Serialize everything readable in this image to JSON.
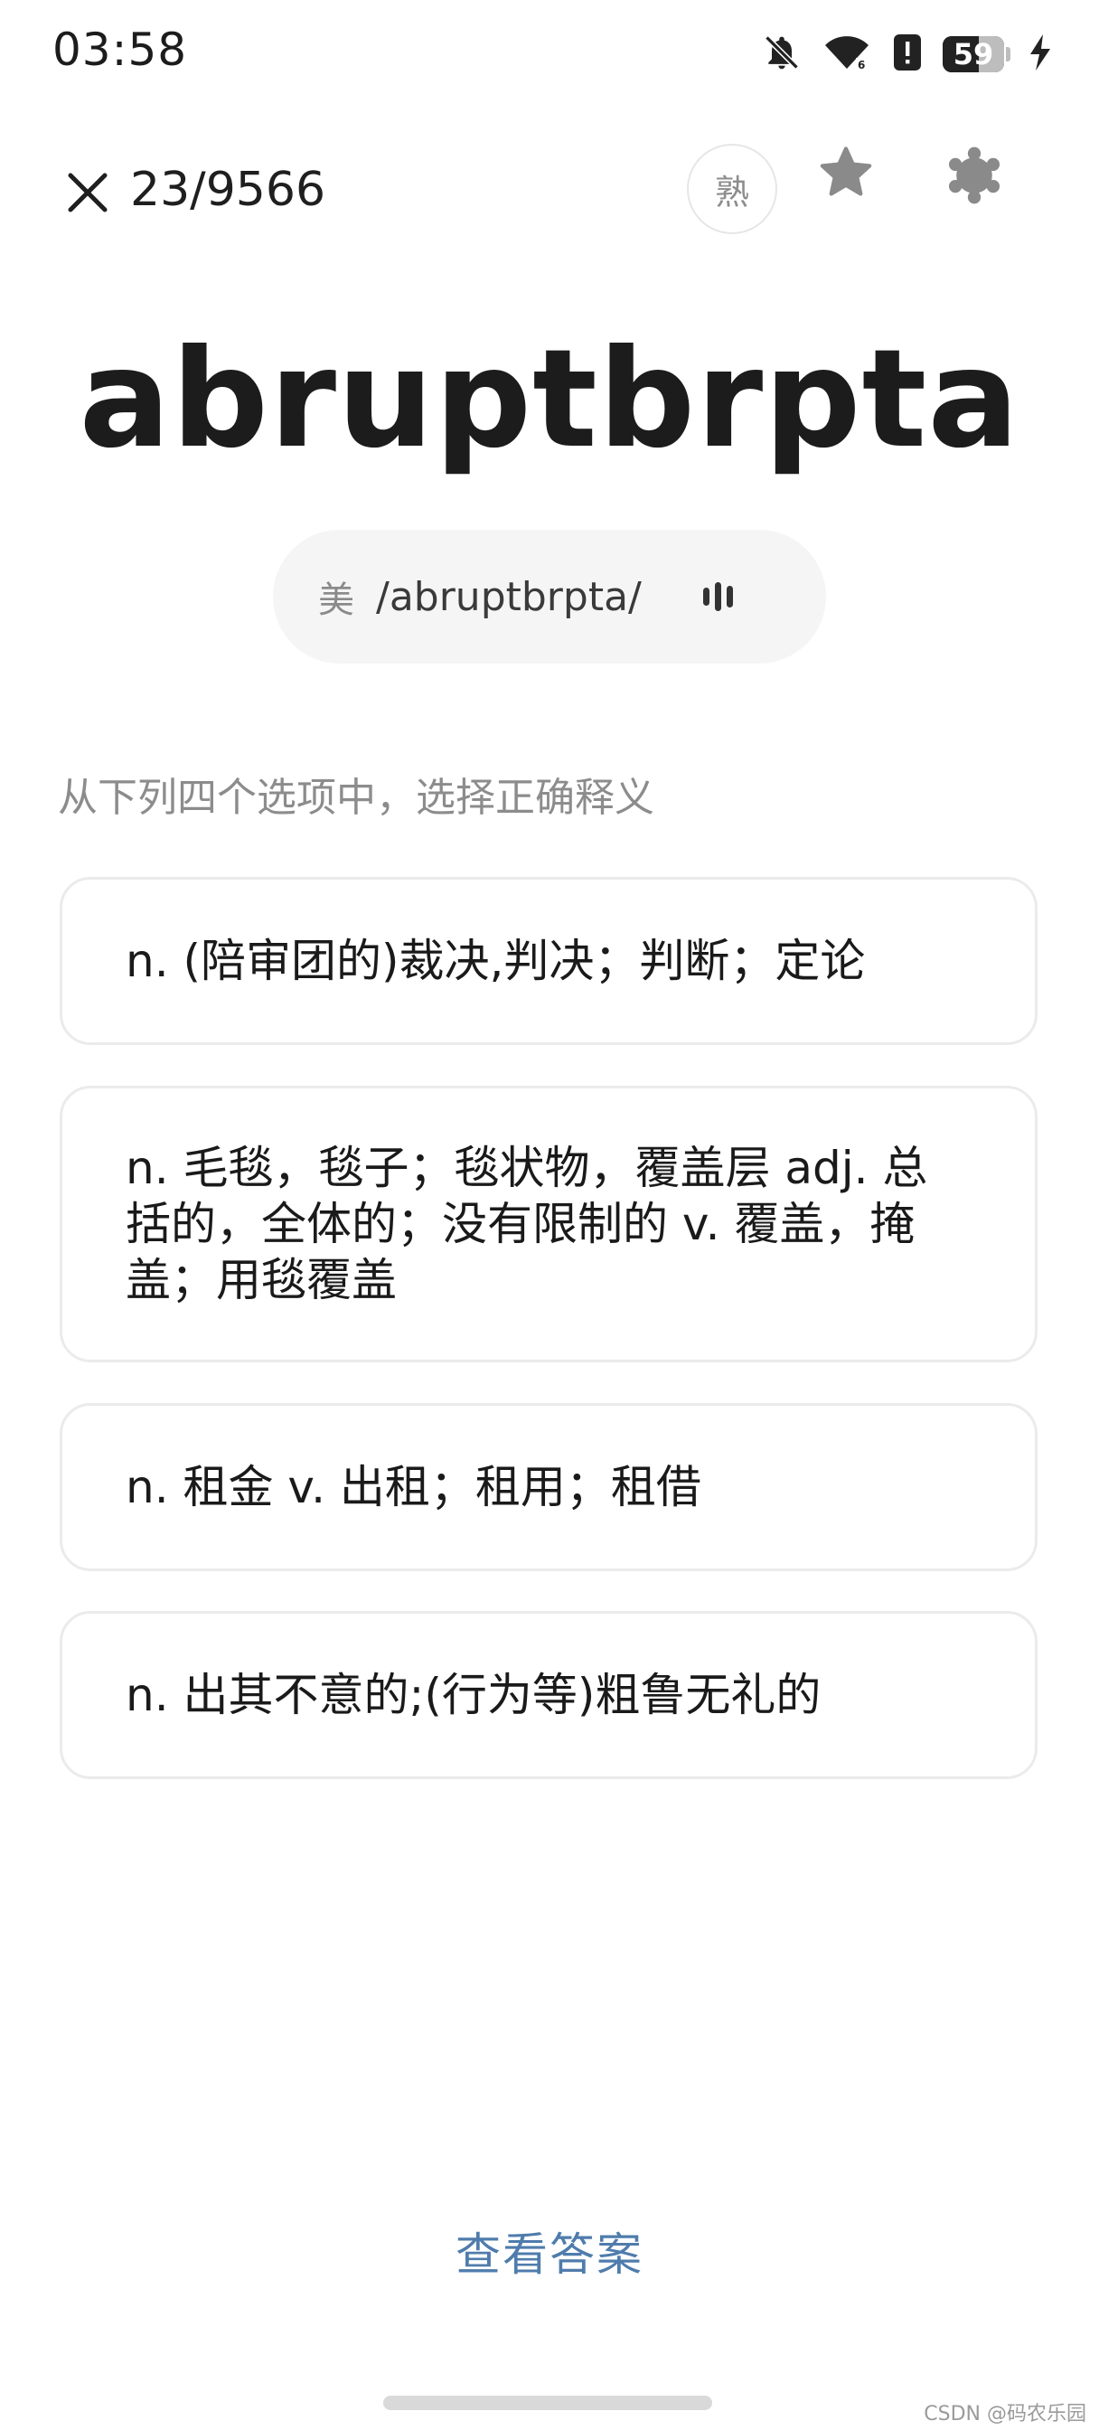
{
  "status_bar": {
    "time": "03:58",
    "battery_level": "59",
    "battery_fraction": 0.59,
    "icons": [
      "bell-off-icon",
      "wifi-icon",
      "alert-icon",
      "battery-icon",
      "charging-icon"
    ]
  },
  "top_bar": {
    "progress": "23/9566",
    "familiar_label": "熟",
    "icons": [
      "close-icon",
      "star-icon",
      "settings-gear-icon"
    ]
  },
  "word": {
    "text": "abruptbrpta",
    "region": "美",
    "phonetic": "/abruptbrpta/",
    "sound_icon": "audio-wave-icon"
  },
  "instruction": "从下列四个选项中，选择正确释义",
  "options": [
    {
      "text": "n. (陪审团的)裁决,判决；判断；定论"
    },
    {
      "text": "n. 毛毯，毯子；毯状物，覆盖层 adj. 总括的，全体的；没有限制的 v. 覆盖，掩盖；用毯覆盖"
    },
    {
      "text": "n. 租金 v. 出租；租用；租借"
    },
    {
      "text": "n. 出其不意的;(行为等)粗鲁无礼的"
    }
  ],
  "show_answer_label": "查看答案",
  "watermark": "CSDN @码农乐园",
  "colors": {
    "accent": "#4f7cac",
    "icon_gray": "#8a8a8a",
    "card_border": "#ebebeb",
    "pill_bg": "#f5f5f5"
  }
}
